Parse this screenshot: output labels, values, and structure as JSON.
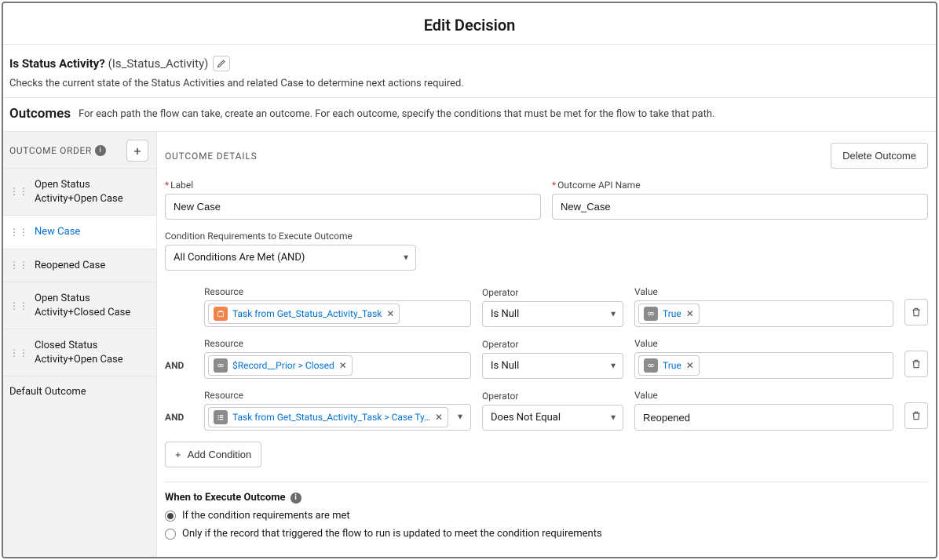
{
  "modal_title": "Edit Decision",
  "decision": {
    "label": "Is Status Activity?",
    "api_name": "(Is_Status_Activity)",
    "description": "Checks the current state of the Status Activities and related Case to determine next actions required."
  },
  "outcomes_heading": "Outcomes",
  "outcomes_help": "For each path the flow can take, create an outcome. For each outcome, specify the conditions that must be met for the flow to take that path.",
  "outcome_order_label": "OUTCOME ORDER",
  "outcomes": [
    {
      "label": "Open Status Activity+Open Case"
    },
    {
      "label": "New Case"
    },
    {
      "label": "Reopened Case"
    },
    {
      "label": "Open Status Activity+Closed Case"
    },
    {
      "label": "Closed Status Activity+Open Case"
    }
  ],
  "default_outcome_label": "Default Outcome",
  "details": {
    "section_title": "OUTCOME DETAILS",
    "delete_btn": "Delete Outcome",
    "label_field": "Label",
    "api_field": "Outcome API Name",
    "label_value": "New Case",
    "api_value": "New_Case",
    "condreq_label": "Condition Requirements to Execute Outcome",
    "condreq_value": "All Conditions Are Met (AND)",
    "headers": {
      "resource": "Resource",
      "operator": "Operator",
      "value": "Value"
    },
    "logic_and": "AND",
    "conditions": [
      {
        "resource": "Task from Get_Status_Activity_Task",
        "res_icon": "orange",
        "operator": "Is Null",
        "value_pill": "True",
        "value_text": "",
        "picker": false
      },
      {
        "resource": "$Record__Prior > Closed",
        "res_icon": "link",
        "operator": "Is Null",
        "value_pill": "True",
        "value_text": "",
        "picker": false
      },
      {
        "resource": "Task from Get_Status_Activity_Task > Case Ty…",
        "res_icon": "gray",
        "operator": "Does Not Equal",
        "value_pill": "",
        "value_text": "Reopened",
        "picker": true
      }
    ],
    "add_condition": "Add Condition",
    "exec_heading": "When to Execute Outcome",
    "exec_opt1": "If the condition requirements are met",
    "exec_opt2": "Only if the record that triggered the flow to run is updated to meet the condition requirements"
  }
}
